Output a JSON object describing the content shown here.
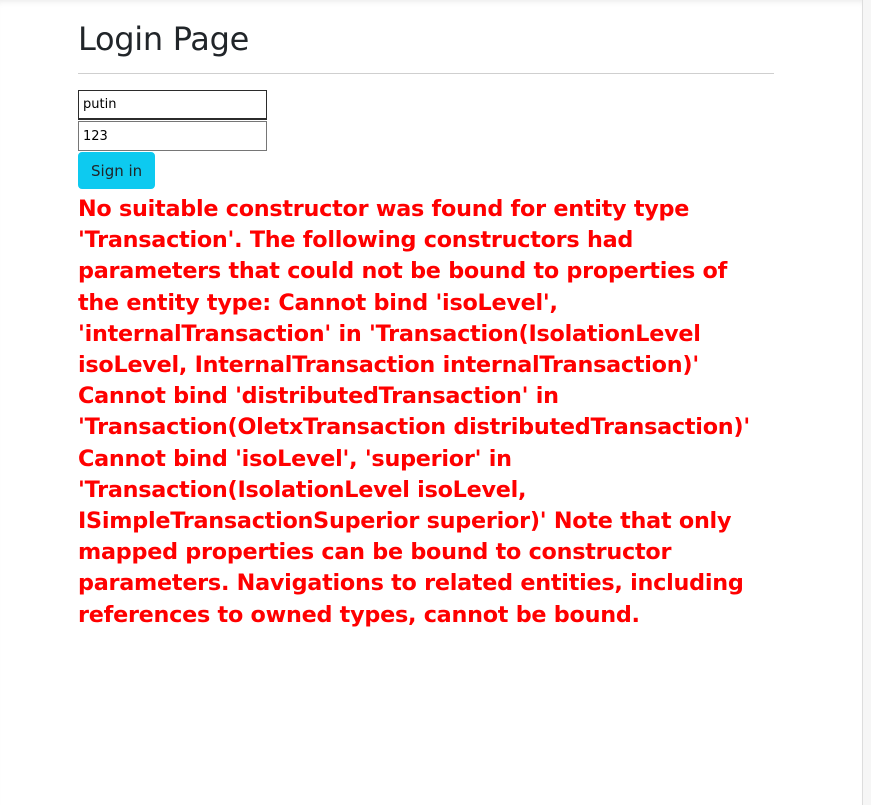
{
  "page": {
    "title": "Login Page"
  },
  "form": {
    "username_value": "putin",
    "password_value": "123",
    "signin_label": "Sign in"
  },
  "error": {
    "message": "No suitable constructor was found for entity type 'Transaction'. The following constructors had parameters that could not be bound to properties of the entity type: Cannot bind 'isoLevel', 'internalTransaction' in 'Transaction(IsolationLevel isoLevel, InternalTransaction internalTransaction)' Cannot bind 'distributedTransaction' in 'Transaction(OletxTransaction distributedTransaction)' Cannot bind 'isoLevel', 'superior' in 'Transaction(IsolationLevel isoLevel, ISimpleTransactionSuperior superior)' Note that only mapped properties can be bound to constructor parameters. Navigations to related entities, including references to owned types, cannot be bound.",
    "color": "#ff0000"
  },
  "colors": {
    "button_bg": "#0dcaf0",
    "title_text": "#212529"
  }
}
